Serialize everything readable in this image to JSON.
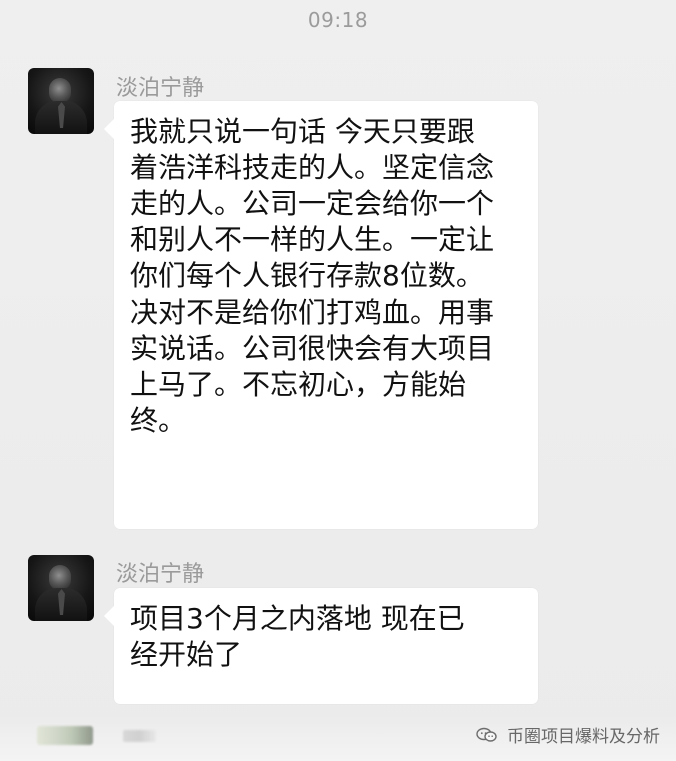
{
  "screen": {
    "timestamp": "09:18"
  },
  "messages": [
    {
      "sender": "淡泊宁静",
      "text": "我就只说一句话 今天只要跟\n着浩洋科技走的人。坚定信念\n走的人。公司一定会给你一个\n和别人不一样的人生。一定让\n你们每个人银行存款8位数。\n决对不是给你们打鸡血。用事\n实说话。公司很快会有大项目\n上马了。不忘初心，方能始\n终。"
    },
    {
      "sender": "淡泊宁静",
      "text": "项目3个月之内落地 现在已\n经开始了"
    }
  ],
  "footer": {
    "watermark_text": "币圈项目爆料及分析",
    "watermark_icon": "wechat-bubbles-icon"
  }
}
